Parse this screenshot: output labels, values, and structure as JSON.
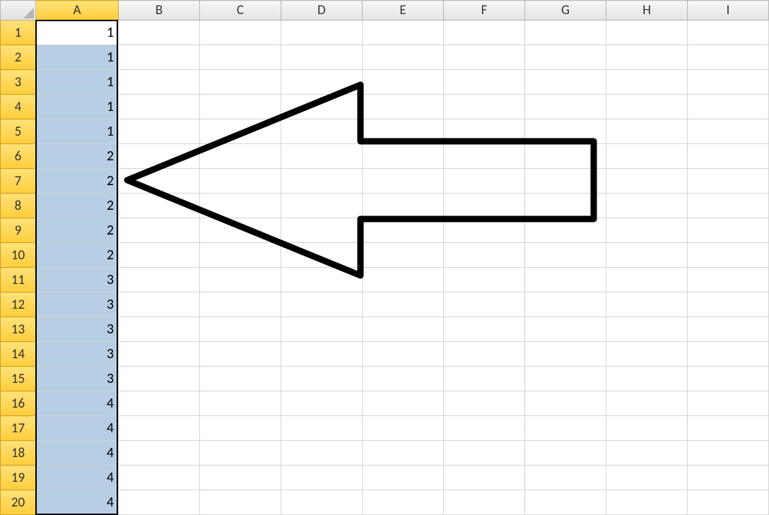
{
  "columns": [
    "A",
    "B",
    "C",
    "D",
    "E",
    "F",
    "G",
    "H",
    "I"
  ],
  "rows": [
    "1",
    "2",
    "3",
    "4",
    "5",
    "6",
    "7",
    "8",
    "9",
    "10",
    "11",
    "12",
    "13",
    "14",
    "15",
    "16",
    "17",
    "18",
    "19",
    "20"
  ],
  "cells": {
    "A1": "1",
    "A2": "1",
    "A3": "1",
    "A4": "1",
    "A5": "1",
    "A6": "2",
    "A7": "2",
    "A8": "2",
    "A9": "2",
    "A10": "2",
    "A11": "3",
    "A12": "3",
    "A13": "3",
    "A14": "3",
    "A15": "3",
    "A16": "4",
    "A17": "4",
    "A18": "4",
    "A19": "4",
    "A20": "4"
  },
  "selection": {
    "column": "A",
    "active_cell": "A1",
    "range_start_row": 1,
    "range_end_row": 20
  },
  "annotation": {
    "type": "left-arrow",
    "points_to": "A7"
  }
}
